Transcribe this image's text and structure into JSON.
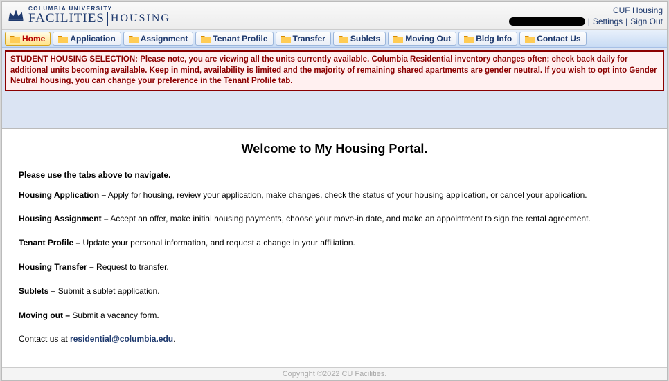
{
  "header": {
    "univ": "COLUMBIA UNIVERSITY",
    "facilities": "FACILITIES",
    "housing": "HOUSING",
    "site_link": "CUF Housing",
    "settings": "Settings",
    "signout": "Sign Out",
    "sep": " | "
  },
  "nav": {
    "home": "Home",
    "application": "Application",
    "assignment": "Assignment",
    "tenant": "Tenant Profile",
    "transfer": "Transfer",
    "sublets": "Sublets",
    "moving": "Moving Out",
    "bldg": "Bldg Info",
    "contact": "Contact Us"
  },
  "notice": "STUDENT HOUSING SELECTION: Please note, you are viewing all the units currently available. Columbia Residential inventory changes often; check back daily for additional units becoming available. Keep in mind, availability is limited and the majority of remaining shared apartments are gender neutral. If you wish to opt into Gender Neutral housing, you can change your preference in the Tenant Profile tab.",
  "main": {
    "welcome": "Welcome to My Housing Portal.",
    "intro": "Please use the tabs above to navigate.",
    "s1_label": "Housing Application –",
    "s1_text": " Apply for housing, review your application, make changes, check the status of your housing application, or cancel your application.",
    "s2_label": "Housing Assignment –",
    "s2_text": " Accept an offer, make initial housing payments, choose your move-in date, and make an appointment to sign the rental agreement.",
    "s3_label": "Tenant Profile –",
    "s3_text": " Update your personal information, and request a change in your affiliation.",
    "s4_label": "Housing Transfer –",
    "s4_text": " Request to transfer.",
    "s5_label": "Sublets –",
    "s5_text": " Submit a sublet application.",
    "s6_label": "Moving out –",
    "s6_text": " Submit a vacancy form.",
    "contact_pre": "Contact us at ",
    "contact_email": "residential@columbia.edu",
    "contact_post": "."
  },
  "footer": "Copyright ©2022 CU Facilities."
}
